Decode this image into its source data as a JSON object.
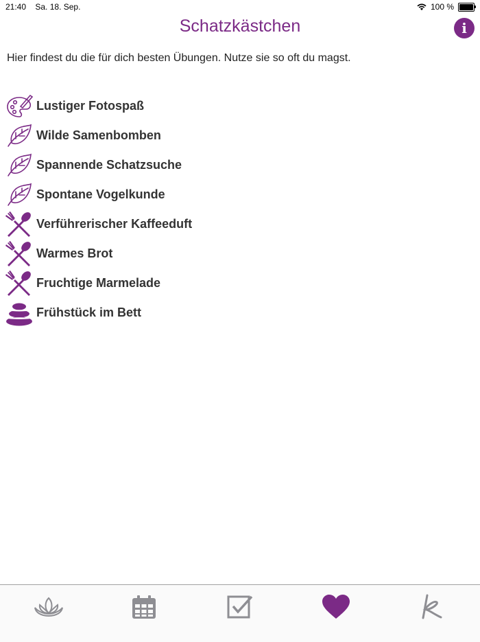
{
  "status_bar": {
    "time": "21:40",
    "date": "Sa. 18. Sep.",
    "battery": "100 %"
  },
  "header": {
    "title": "Schatzkästchen",
    "info_icon": "info-icon"
  },
  "intro_text": "Hier findest du die für dich besten Übungen. Nutze sie so oft du magst.",
  "exercises": [
    {
      "label": "Lustiger Fotospaß",
      "icon": "palette-icon"
    },
    {
      "label": "Wilde Samenbomben",
      "icon": "leaf-icon"
    },
    {
      "label": "Spannende Schatzsuche",
      "icon": "leaf-icon"
    },
    {
      "label": "Spontane Vogelkunde",
      "icon": "leaf-icon"
    },
    {
      "label": "Verführerischer Kaffeeduft",
      "icon": "fork-spoon-icon"
    },
    {
      "label": "Warmes Brot",
      "icon": "fork-spoon-icon"
    },
    {
      "label": "Fruchtige Marmelade",
      "icon": "fork-spoon-icon"
    },
    {
      "label": "Frühstück im Bett",
      "icon": "stones-icon"
    }
  ],
  "tab_bar": {
    "tabs": [
      {
        "icon": "lotus-icon",
        "active": false
      },
      {
        "icon": "calendar-icon",
        "active": false
      },
      {
        "icon": "checkbox-icon",
        "active": false
      },
      {
        "icon": "heart-icon",
        "active": true
      },
      {
        "icon": "k-logo-icon",
        "active": false
      }
    ]
  },
  "colors": {
    "accent": "#7b2a86",
    "inactive_tab": "#8e8e93",
    "text": "#333333"
  }
}
